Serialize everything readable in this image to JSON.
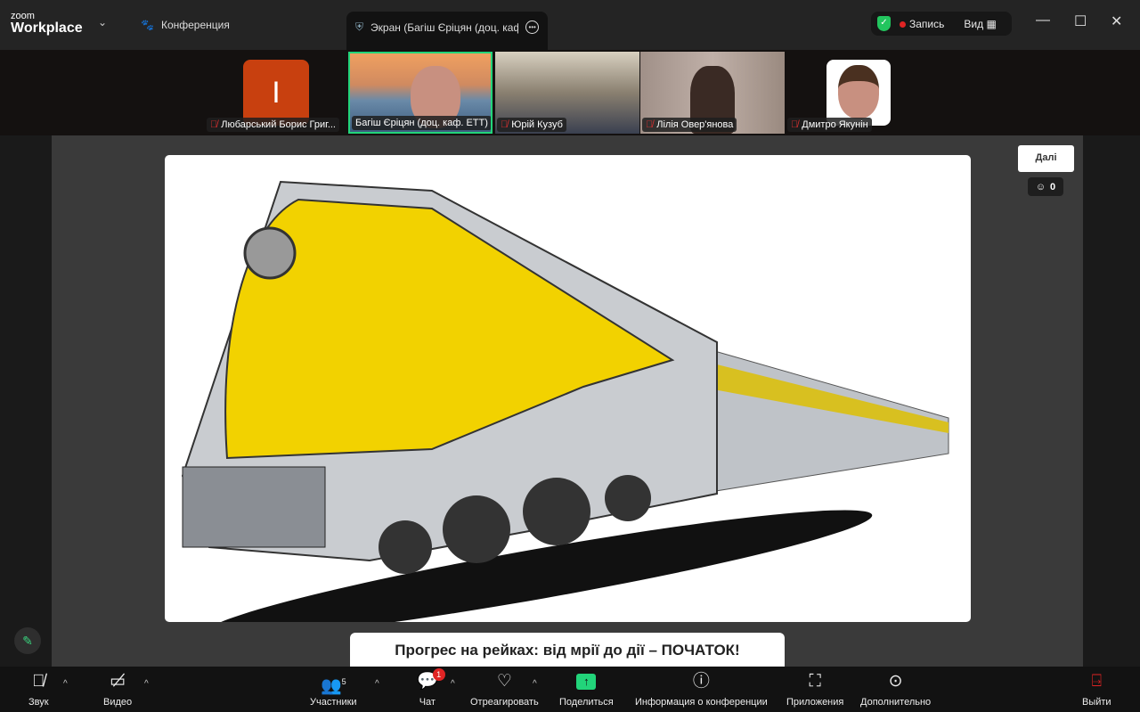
{
  "app": {
    "logo_small": "zoom",
    "logo_big": "Workplace"
  },
  "tabs": {
    "conference": "Конференция",
    "screen": "Экран (Багіш Єріцян (доц. каф. ЕТТ))"
  },
  "status": {
    "record": "Запись",
    "view": "Вид"
  },
  "participants": [
    {
      "name": "Любарський Борис Григ...",
      "initial": "I",
      "muted": true,
      "color": "#c8400f"
    },
    {
      "name": "Багіш Єріцян (доц. каф. ЕТТ)",
      "muted": false,
      "active": true
    },
    {
      "name": "Юрій Кузуб",
      "muted": true
    },
    {
      "name": "Лілія Овер'янова",
      "muted": true
    },
    {
      "name": "Дмитро Якунін",
      "muted": true
    }
  ],
  "stage": {
    "next_label": "Далі",
    "reactions_count": "0",
    "caption": "Прогрес на рейках: від мрії до дії – ПОЧАТОК!"
  },
  "toolbar": {
    "audio": "Звук",
    "video": "Видео",
    "participants": "Участники",
    "participants_count": "5",
    "chat": "Чат",
    "chat_badge": "1",
    "react": "Отреагировать",
    "share": "Поделиться",
    "info": "Информация о конференции",
    "apps": "Приложения",
    "more": "Дополнительно",
    "leave": "Выйти"
  },
  "colors": {
    "active_speaker": "#22d47a",
    "record": "#e02424",
    "share": "#22d47a"
  }
}
